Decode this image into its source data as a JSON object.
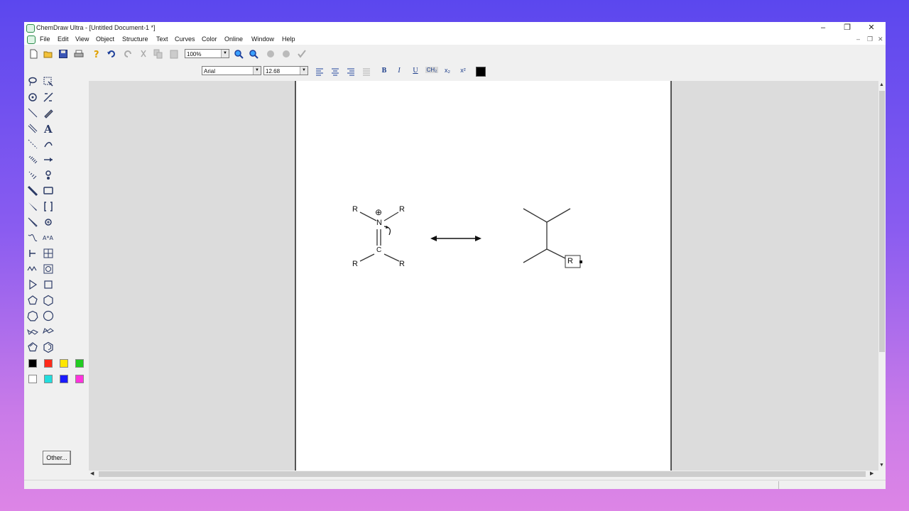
{
  "window": {
    "title": "ChemDraw Ultra - [Untitled Document-1 *]",
    "controls": {
      "minimize": "–",
      "restore": "❐",
      "close": "✕"
    }
  },
  "menu": {
    "items": [
      "File",
      "Edit",
      "View",
      "Object",
      "Structure",
      "Text",
      "Curves",
      "Color",
      "Online",
      "Window",
      "Help"
    ],
    "mdi": {
      "minimize": "–",
      "restore": "❐",
      "close": "✕"
    }
  },
  "toolbar": {
    "zoom": "100%",
    "icons": [
      "new-icon",
      "open-icon",
      "save-icon",
      "print-icon",
      "help-icon",
      "undo-icon",
      "redo-icon",
      "cut-icon",
      "copy-icon",
      "paste-icon",
      "zoom-in-icon",
      "zoom-out-icon",
      "clean-structure-icon",
      "query-icon",
      "check-structure-icon"
    ]
  },
  "format_bar": {
    "font": "Arial",
    "size": "12.68",
    "bold": "B",
    "italic": "I",
    "underline": "U",
    "formula": "CH₂",
    "subscript": "x₂",
    "superscript": "x²"
  },
  "palette": {
    "colors": [
      "#000000",
      "#ff2a1a",
      "#ffe600",
      "#22cc22",
      "#ffffff",
      "#22dddd",
      "#1a1aff",
      "#ff33dd"
    ],
    "other_label": "Other..."
  },
  "drawing": {
    "left_molecule": {
      "atoms": [
        "R",
        "R",
        "N",
        "R",
        "R",
        "C"
      ],
      "charge": "⊕"
    },
    "right_molecule": {
      "label": "R"
    }
  }
}
